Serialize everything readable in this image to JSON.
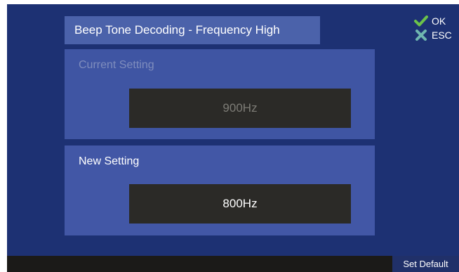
{
  "title": "Beep Tone Decoding - Frequency High",
  "current_setting": {
    "label": "Current Setting",
    "value": "900Hz"
  },
  "new_setting": {
    "label": "New Setting",
    "value": "800Hz"
  },
  "softkeys": {
    "ok_label": "OK",
    "ok_icon": "check-icon",
    "esc_label": "ESC",
    "esc_icon": "x-icon"
  },
  "bottom_bar": {
    "set_default_label": "Set Default"
  },
  "colors": {
    "screen_background": "#1d3173",
    "panel": "#3f55a3",
    "value_box": "#2b2a27",
    "ok_green": "#6cc24a",
    "esc_teal": "#6fb6b0"
  }
}
